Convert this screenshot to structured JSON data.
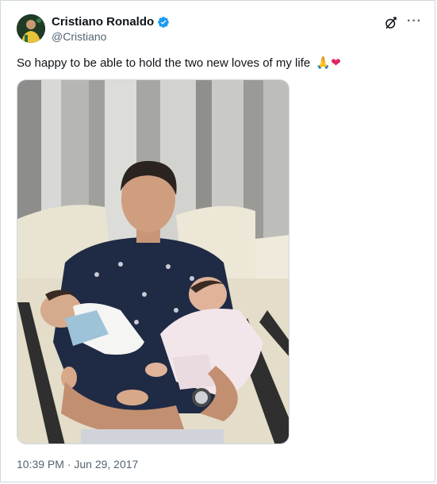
{
  "author": {
    "name": "Cristiano Ronaldo",
    "handle": "@Cristiano",
    "verified": true,
    "verified_color": "#1d9bf0"
  },
  "header": {
    "grok_icon": "grok-icon",
    "more_icon": "more-icon",
    "more_label": "···"
  },
  "tweet": {
    "text": "So happy to be able to hold the two new loves of my life",
    "emoji_hands": "🙏",
    "emoji_heart": "❤"
  },
  "media": {
    "type": "photo"
  },
  "footer": {
    "timestamp": "10:39 PM · Jun 29, 2017"
  },
  "colors": {
    "text": "#0f1419",
    "secondary": "#536471",
    "border": "#cfd9de"
  }
}
